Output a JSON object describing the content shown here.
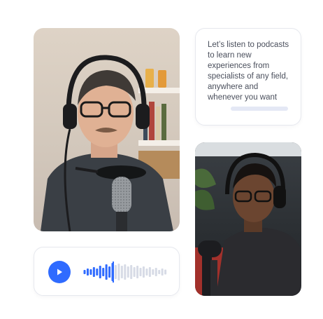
{
  "text_card": {
    "message": "Let’s listen to podcasts to learn new experiences from specialists of any field, anywhere and whenever you want"
  },
  "player": {
    "play_icon": "play-icon",
    "progress": 0.35,
    "accent_color": "#2f6bff"
  },
  "photos": {
    "left": {
      "subject": "man-with-headphones-at-microphone"
    },
    "right": {
      "subject": "man-with-headphones-at-microphone"
    }
  }
}
